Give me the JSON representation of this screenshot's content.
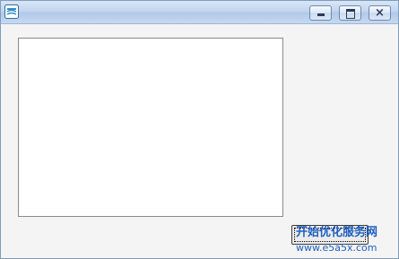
{
  "window": {
    "title": "",
    "icon": "app-icon",
    "controls": [
      "minimize-icon",
      "maximize-icon",
      "close-icon"
    ],
    "close_glyph": "×"
  },
  "main": {
    "textarea_value": "",
    "button_label": ""
  },
  "watermark": {
    "text": "开始优化服务网",
    "url": "www.e5a5x.com"
  },
  "colors": {
    "titlebar": "#c3d6ef",
    "client_bg": "#f4f4f4",
    "watermark": "#1f5fbf"
  }
}
